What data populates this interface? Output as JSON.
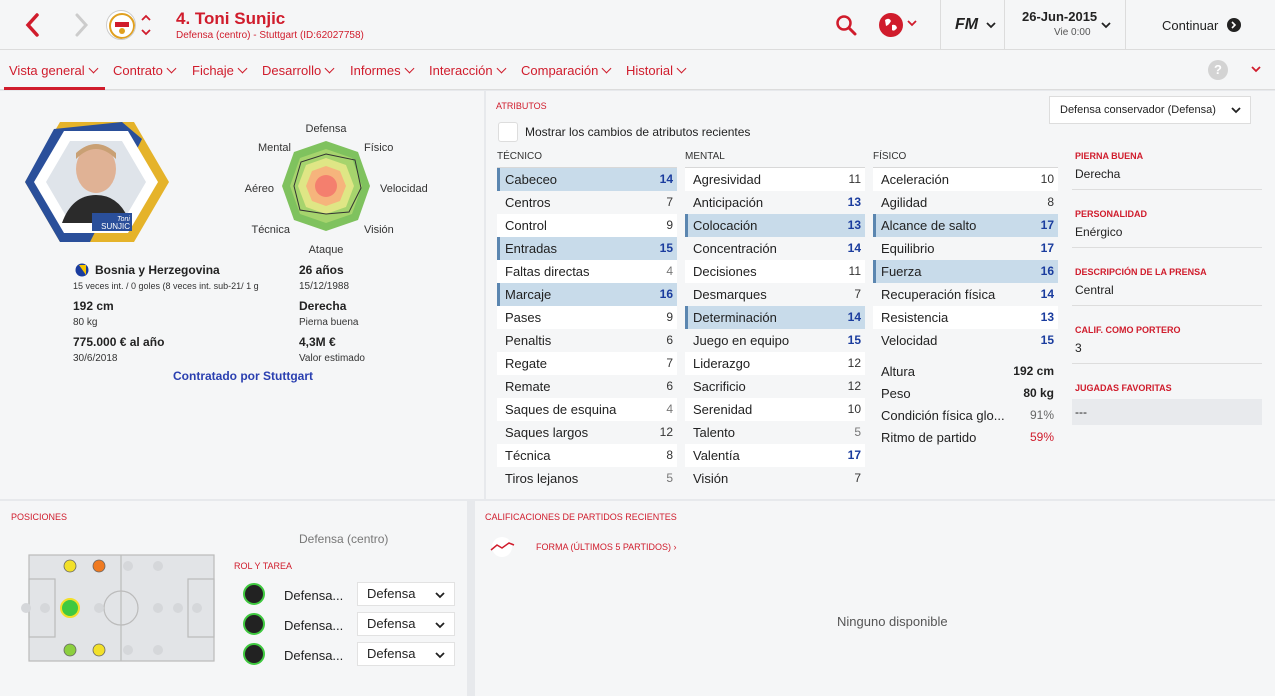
{
  "header": {
    "title": "4. Toni Sunjic",
    "subtitle": "Defensa (centro) - Stuttgart (ID:62027758)",
    "game_logo": "FM",
    "date": "26-Jun-2015",
    "day": "Vie 0:00",
    "continue_label": "Continuar",
    "accent_color": "#d01c2c"
  },
  "tabs": [
    {
      "label": "Vista general"
    },
    {
      "label": "Contrato"
    },
    {
      "label": "Fichaje"
    },
    {
      "label": "Desarrollo"
    },
    {
      "label": "Informes"
    },
    {
      "label": "Interacción"
    },
    {
      "label": "Comparación"
    },
    {
      "label": "Historial"
    }
  ],
  "help_label": "?",
  "profile": {
    "card_first": "Toni",
    "card_last": "SUNJIC",
    "nation": "Bosnia y Herzegovina",
    "caps": "15 veces int. / 0 goles (8 veces int. sub-21/ 1 g",
    "age": "26 años",
    "dob": "15/12/1988",
    "height": "192 cm",
    "weight": "80 kg",
    "foot": "Derecha",
    "foot_label": "Pierna buena",
    "wage": "775.000 € al año",
    "contract_end": "30/6/2018",
    "value": "4,3M €",
    "value_label": "Valor estimado",
    "contract_link": "Contratado por Stuttgart"
  },
  "radar": {
    "labels": {
      "top": "Defensa",
      "top_right": "Físico",
      "right": "Velocidad",
      "bottom_right": "Visión",
      "bottom": "Ataque",
      "bottom_left": "Técnica",
      "left": "Aéreo",
      "top_left": "Mental"
    }
  },
  "attributes": {
    "section_label": "ATRIBUTOS",
    "role_selector": "Defensa conservador (Defensa)",
    "checkbox_label": "Mostrar los cambios de atributos recientes",
    "technical_label": "TÉCNICO",
    "mental_label": "MENTAL",
    "physical_label": "FÍSICO",
    "technical": [
      {
        "name": "Cabeceo",
        "value": "14",
        "hi": true
      },
      {
        "name": "Centros",
        "value": "7"
      },
      {
        "name": "Control",
        "value": "9"
      },
      {
        "name": "Entradas",
        "value": "15",
        "hi": true
      },
      {
        "name": "Faltas directas",
        "value": "4"
      },
      {
        "name": "Marcaje",
        "value": "16",
        "hi": true
      },
      {
        "name": "Pases",
        "value": "9"
      },
      {
        "name": "Penaltis",
        "value": "6"
      },
      {
        "name": "Regate",
        "value": "7"
      },
      {
        "name": "Remate",
        "value": "6"
      },
      {
        "name": "Saques de esquina",
        "value": "4"
      },
      {
        "name": "Saques largos",
        "value": "12"
      },
      {
        "name": "Técnica",
        "value": "8"
      },
      {
        "name": "Tiros lejanos",
        "value": "5"
      }
    ],
    "mental": [
      {
        "name": "Agresividad",
        "value": "11"
      },
      {
        "name": "Anticipación",
        "value": "13"
      },
      {
        "name": "Colocación",
        "value": "13",
        "hi": true
      },
      {
        "name": "Concentración",
        "value": "14"
      },
      {
        "name": "Decisiones",
        "value": "11"
      },
      {
        "name": "Desmarques",
        "value": "7"
      },
      {
        "name": "Determinación",
        "value": "14",
        "hi": true
      },
      {
        "name": "Juego en equipo",
        "value": "15"
      },
      {
        "name": "Liderazgo",
        "value": "12"
      },
      {
        "name": "Sacrificio",
        "value": "12"
      },
      {
        "name": "Serenidad",
        "value": "10"
      },
      {
        "name": "Talento",
        "value": "5"
      },
      {
        "name": "Valentía",
        "value": "17"
      },
      {
        "name": "Visión",
        "value": "7"
      }
    ],
    "physical": [
      {
        "name": "Aceleración",
        "value": "10"
      },
      {
        "name": "Agilidad",
        "value": "8"
      },
      {
        "name": "Alcance de salto",
        "value": "17",
        "hi": true
      },
      {
        "name": "Equilibrio",
        "value": "17"
      },
      {
        "name": "Fuerza",
        "value": "16",
        "hi": true
      },
      {
        "name": "Recuperación física",
        "value": "14"
      },
      {
        "name": "Resistencia",
        "value": "13"
      },
      {
        "name": "Velocidad",
        "value": "15"
      }
    ],
    "extra": [
      {
        "name": "Altura",
        "value": "192 cm"
      },
      {
        "name": "Peso",
        "value": "80 kg"
      },
      {
        "name": "Condición física glo...",
        "value": "91%"
      },
      {
        "name": "Ritmo de partido",
        "value": "59%"
      }
    ]
  },
  "info": [
    {
      "label": "PIERNA BUENA",
      "value": "Derecha"
    },
    {
      "label": "PERSONALIDAD",
      "value": "Enérgico"
    },
    {
      "label": "DESCRIPCIÓN DE LA PRENSA",
      "value": "Central"
    },
    {
      "label": "CALIF. COMO PORTERO",
      "value": "3"
    },
    {
      "label": "JUGADAS FAVORITAS",
      "value": "---"
    }
  ],
  "positions": {
    "section_label": "POSICIONES",
    "current": "Defensa (centro)",
    "role_label": "ROL Y TAREA",
    "roles": [
      {
        "name": "Defensa...",
        "duty": "Defensa"
      },
      {
        "name": "Defensa...",
        "duty": "Defensa"
      },
      {
        "name": "Defensa...",
        "duty": "Defensa"
      }
    ]
  },
  "ratings": {
    "section_label": "CALIFICACIONES DE PARTIDOS RECIENTES",
    "form_label": "FORMA (ÚLTIMOS 5 PARTIDOS) ›",
    "empty": "Ninguno disponible"
  }
}
